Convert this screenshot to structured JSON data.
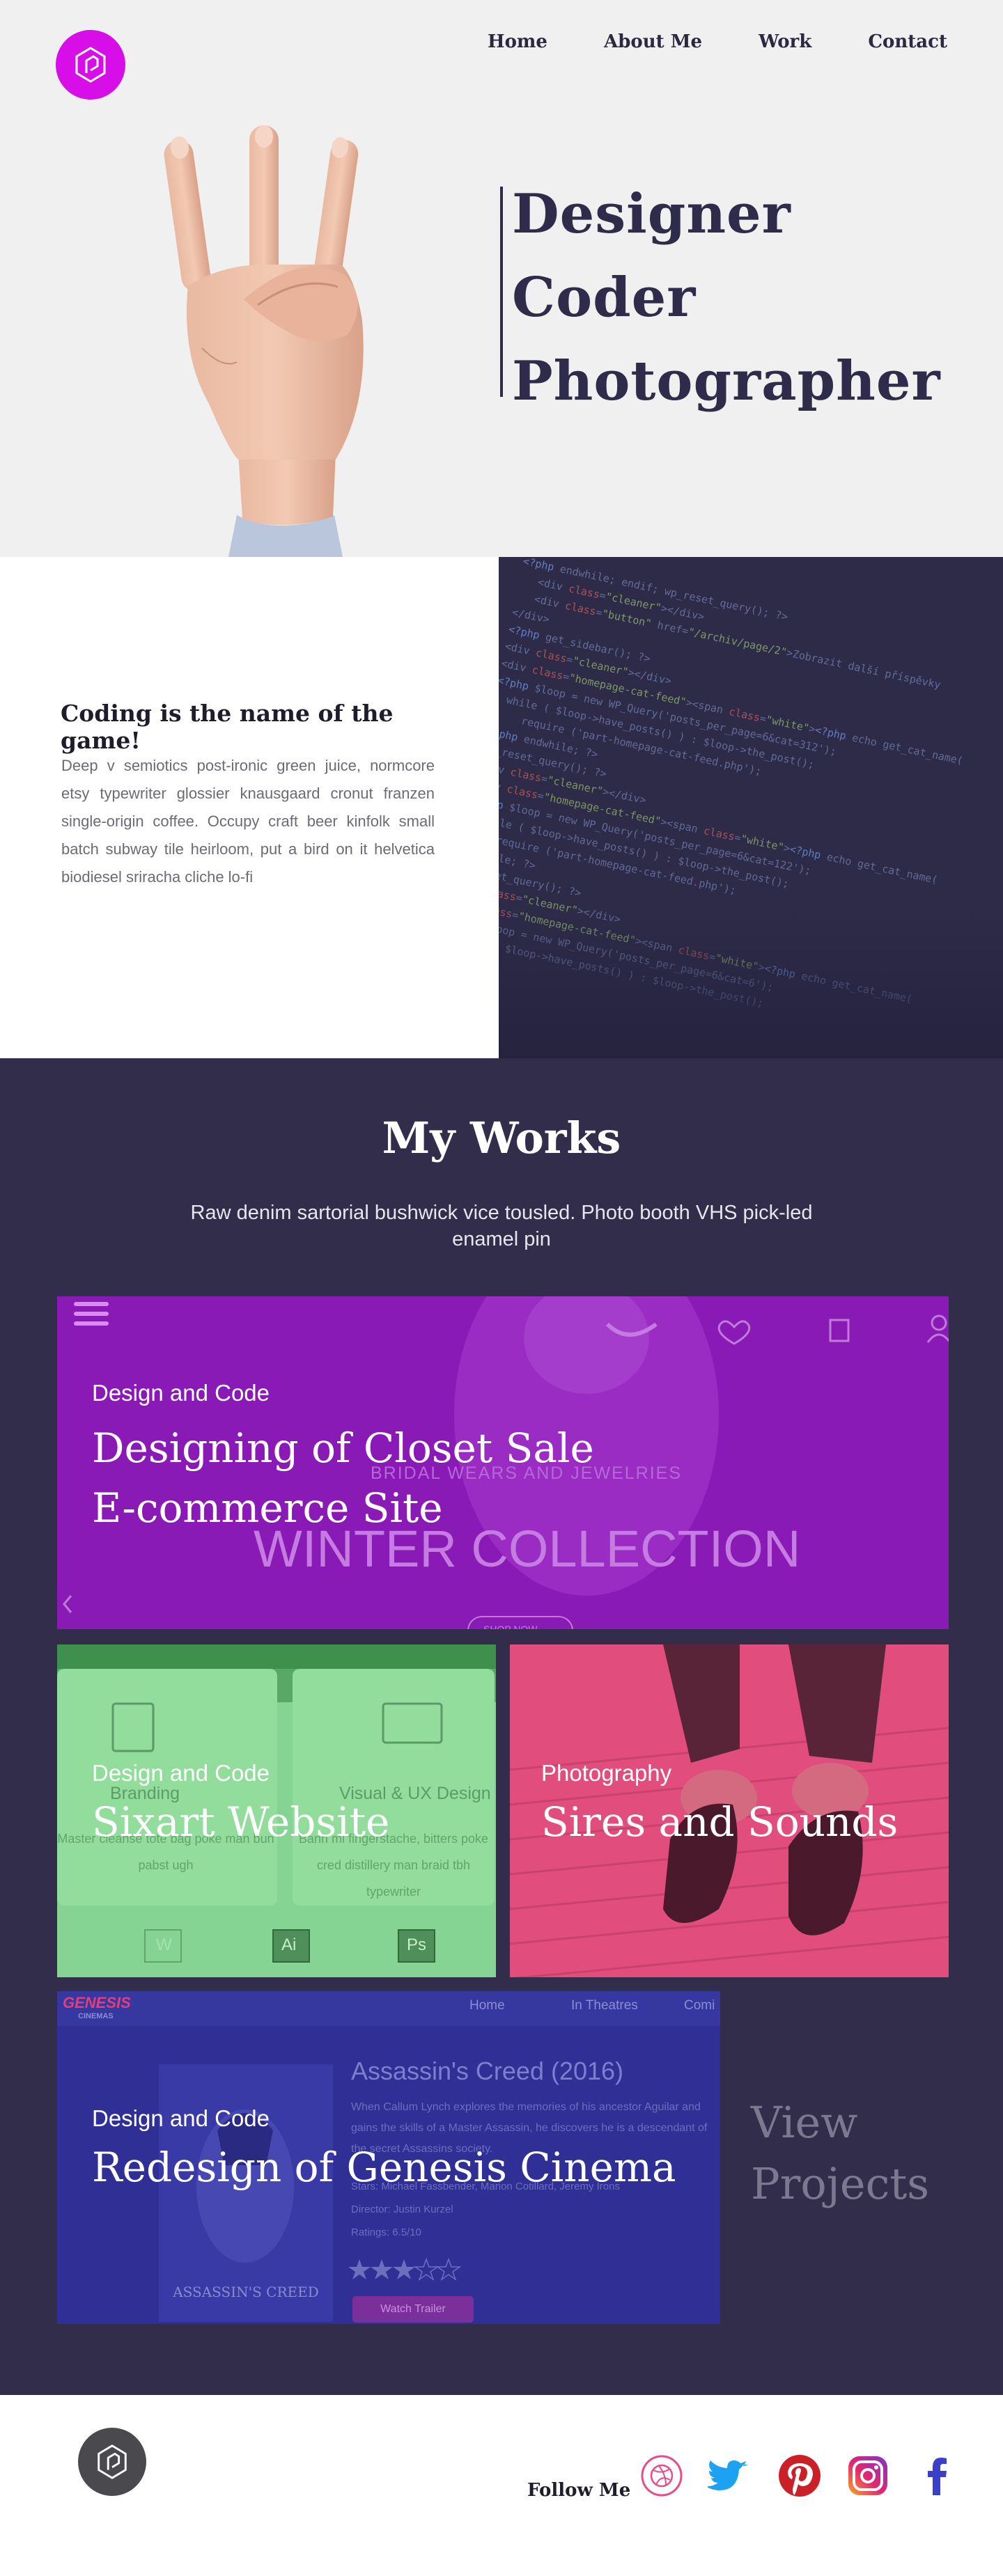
{
  "nav": {
    "items": [
      "Home",
      "About Me",
      "Work",
      "Contact"
    ]
  },
  "hero": {
    "titles": [
      "Designer",
      "Coder",
      "Photographer"
    ]
  },
  "intro": {
    "heading": "Coding is the name of the game!",
    "paragraph": "Deep v semiotics post-ironic green juice, normcore etsy typewriter glossier knausgaard cronut franzen single-origin coffee. Occupy craft beer kinfolk small batch subway tile heirloom, put a bird on it helvetica biodiesel sriracha cliche lo-fi"
  },
  "works": {
    "title": "My Works",
    "subtitle": "Raw denim sartorial bushwick vice tousled. Photo booth VHS pick-led enamel pin",
    "projects": [
      {
        "category": "Design and Code",
        "title_line1": "Designing of Closet Sale",
        "title_line2": "E-commerce Site",
        "bg_text_brand": "BRIDAL WEARS AND JEWELRIES",
        "bg_text_collection": "WINTER COLLECTION",
        "bg_text_button": "SHOP NOW"
      },
      {
        "category": "Design and Code",
        "title": "Sixart Website",
        "bg_text_branding": "Branding",
        "bg_text_visual": "Visual & UX Design",
        "bg_text_desc1": "Master cleanse tote bag poke man bun pabst ugh",
        "bg_text_desc2": "Banh mi fingerstache, bitters poke cred distillery man braid tbh typewriter",
        "bg_text_tools": [
          "W",
          "Ai",
          "Ps"
        ]
      },
      {
        "category": "Photography",
        "title": "Sires and Sounds"
      },
      {
        "category": "Design and Code",
        "title": "Redesign of Genesis Cinema",
        "bg_text_brand": "GENESIS",
        "bg_text_brand_sub": "CINEMAS",
        "bg_text_nav": [
          "Home",
          "In Theatres",
          "Comi"
        ],
        "bg_text_movie": "Assassin's Creed (2016)",
        "bg_text_synopsis": "When Callum Lynch explores the memories of his ancestor Aguilar and gains the skills of a Master Assassin, he discovers he is a descendant of the secret Assassins society.",
        "bg_text_stars": "Stars: Michael Fassbender, Marion Cotillard, Jeremy Irons",
        "bg_text_director": "Director: Justin Kurzel",
        "bg_text_ratings": "Ratings: 6.5/10",
        "bg_text_button": "Watch Trailer",
        "bg_text_poster": "ASSASSIN'S CREED"
      }
    ],
    "view_projects": "View Projects"
  },
  "footer": {
    "follow_label": "Follow Me",
    "social_icons": [
      "dribbble-icon",
      "twitter-icon",
      "pinterest-icon",
      "instagram-icon",
      "facebook-icon"
    ]
  },
  "colors": {
    "accent": "#d80ee8",
    "dark": "#322d4b",
    "closet": "#8a1ab6",
    "sixart": "#86d493",
    "sires": "#e14d7d",
    "genesis": "#2f2f96"
  }
}
